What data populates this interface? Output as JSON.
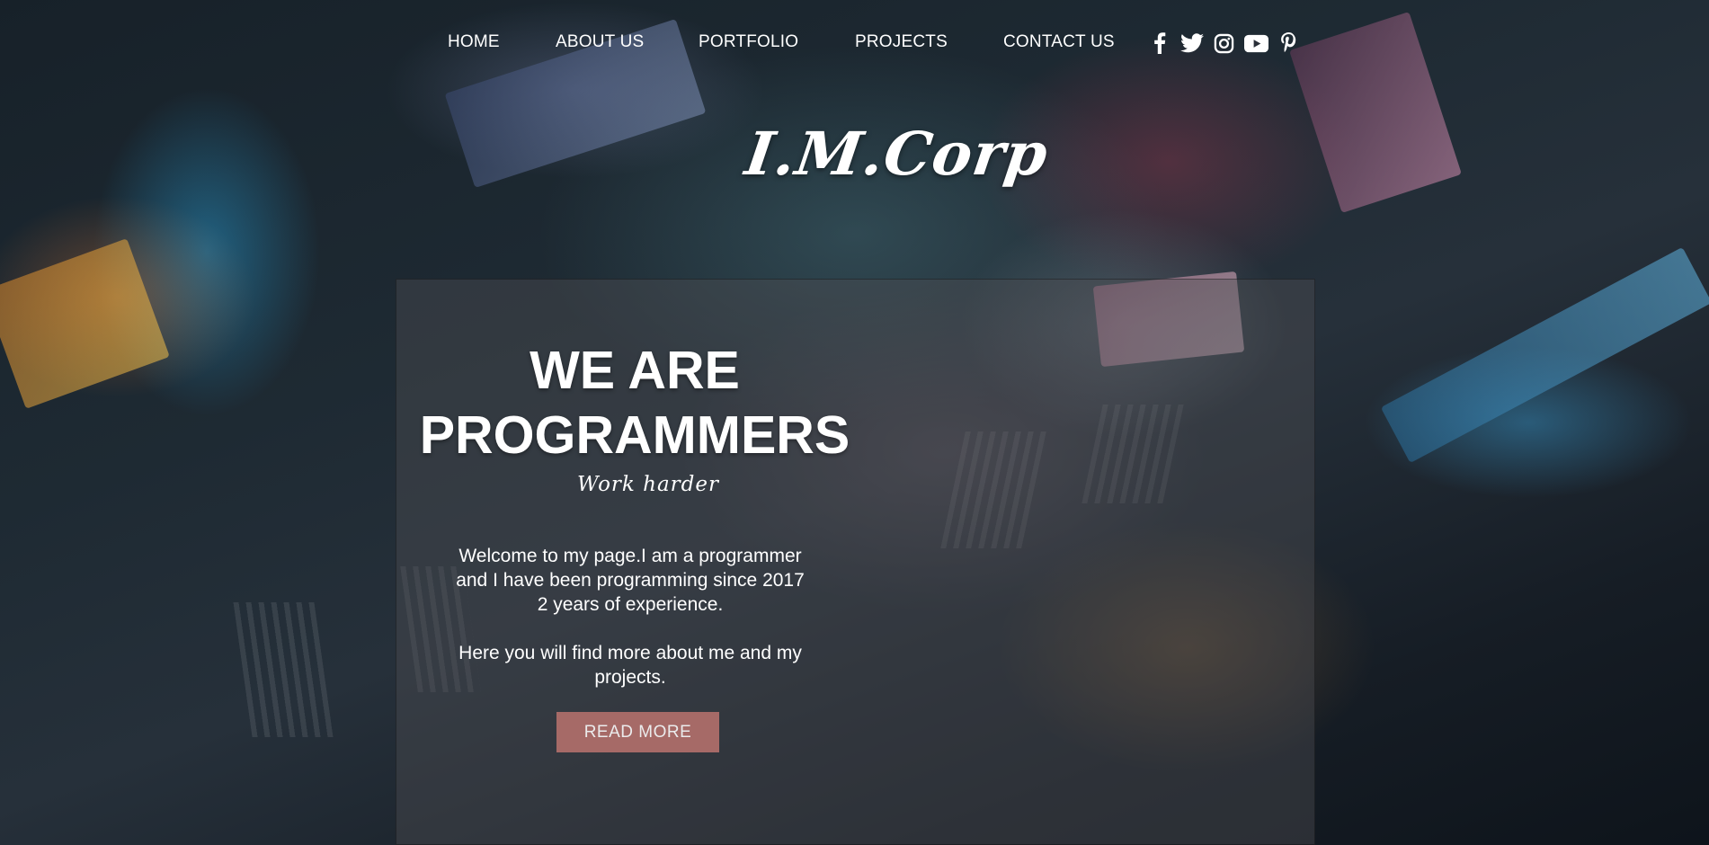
{
  "nav": {
    "items": [
      {
        "label": "HOME"
      },
      {
        "label": "ABOUT US"
      },
      {
        "label": "PORTFOLIO"
      },
      {
        "label": "PROJECTS"
      },
      {
        "label": "CONTACT US"
      }
    ]
  },
  "social": [
    "facebook-icon",
    "twitter-icon",
    "instagram-icon",
    "youtube-icon",
    "pinterest-icon"
  ],
  "logo": "I.M.Corp",
  "hero": {
    "title_line1": "WE ARE",
    "title_line2": "PROGRAMMERS",
    "tagline": "Work harder",
    "paragraph1_line1": "Welcome to my page.I am a programmer",
    "paragraph1_line2": "and I have been programming since 2017",
    "paragraph1_line3": "2 years of experience.",
    "paragraph2_line1": "Here you will find more about me and my",
    "paragraph2_line2": "projects.",
    "button_label": "READ MORE"
  },
  "colors": {
    "button": "#b3706c",
    "text": "#ffffff",
    "panel": "rgba(78,78,84,0.42)"
  }
}
